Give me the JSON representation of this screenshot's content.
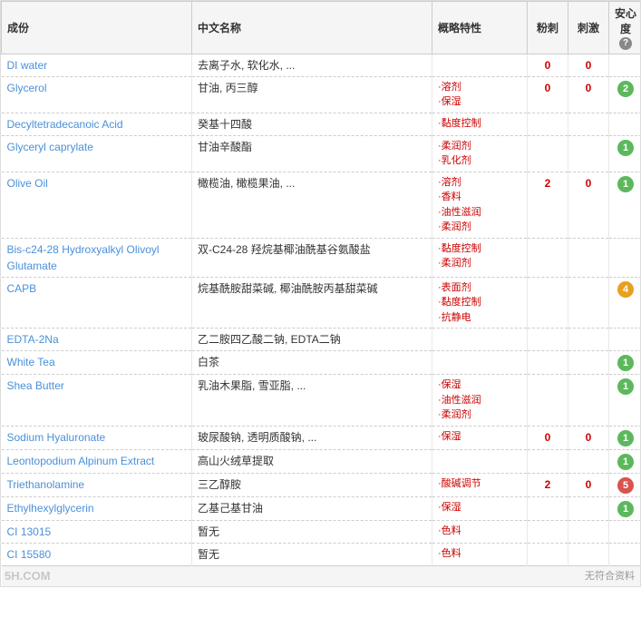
{
  "header": {
    "col_ingredient": "成份",
    "col_chinese": "中文名称",
    "col_general": "概略特性",
    "col_irritant": "粉刺",
    "col_stimulate": "刺激",
    "col_safety": "安心度"
  },
  "rows": [
    {
      "ingredient": "DI water",
      "chinese": "去离子水, 软化水, ...",
      "props": [],
      "irritant": "0",
      "stimulate": "0",
      "safety": null,
      "safety_color": null
    },
    {
      "ingredient": "Glycerol",
      "chinese": "甘油, 丙三醇",
      "props": [
        "·溶剂",
        "·保湿"
      ],
      "irritant": "0",
      "stimulate": "0",
      "safety": "2",
      "safety_color": "green"
    },
    {
      "ingredient": "Decyltetradecanoic Acid",
      "chinese": "癸基十四酸",
      "props": [
        "·黏度控制"
      ],
      "irritant": "",
      "stimulate": "",
      "safety": null,
      "safety_color": null
    },
    {
      "ingredient": "Glyceryl caprylate",
      "chinese": "甘油辛酸酯",
      "props": [
        "·柔润剂",
        "·乳化剂"
      ],
      "irritant": "",
      "stimulate": "",
      "safety": "1",
      "safety_color": "green"
    },
    {
      "ingredient": "Olive Oil",
      "chinese": "橄榄油, 橄榄果油, ...",
      "props": [
        "·溶剂",
        "·香料",
        "·油性滋润",
        "·柔润剂"
      ],
      "irritant": "2",
      "stimulate": "0",
      "safety": "1",
      "safety_color": "green"
    },
    {
      "ingredient": "Bis-c24-28 Hydroxyalkyl Olivoyl Glutamate",
      "chinese": "双-C24-28 羟烷基椰油酰基谷氨酸盐",
      "props": [
        "·黏度控制",
        "·柔润剂"
      ],
      "irritant": "",
      "stimulate": "",
      "safety": null,
      "safety_color": null
    },
    {
      "ingredient": "CAPB",
      "chinese": "烷基酰胺甜菜碱, 椰油酰胺丙基甜菜碱",
      "props": [
        "·表面剂",
        "·黏度控制",
        "·抗静电"
      ],
      "irritant": "",
      "stimulate": "",
      "safety": "4",
      "safety_color": "orange"
    },
    {
      "ingredient": "EDTA-2Na",
      "chinese": "乙二胺四乙酸二钠, EDTA二钠",
      "props": [],
      "irritant": "",
      "stimulate": "",
      "safety": null,
      "safety_color": null
    },
    {
      "ingredient": "White Tea",
      "chinese": "白茶",
      "props": [],
      "irritant": "",
      "stimulate": "",
      "safety": "1",
      "safety_color": "green"
    },
    {
      "ingredient": "Shea Butter",
      "chinese": "乳油木果脂, 雪亚脂, ...",
      "props": [
        "·保湿",
        "·油性滋润",
        "·柔润剂"
      ],
      "irritant": "",
      "stimulate": "",
      "safety": "1",
      "safety_color": "green"
    },
    {
      "ingredient": "Sodium Hyaluronate",
      "chinese": "玻尿酸钠, 透明质酸钠, ...",
      "props": [
        "·保湿"
      ],
      "irritant": "0",
      "stimulate": "0",
      "safety": "1",
      "safety_color": "green"
    },
    {
      "ingredient": "Leontopodium Alpinum Extract",
      "chinese": "高山火绒草提取",
      "props": [],
      "irritant": "",
      "stimulate": "",
      "safety": "1",
      "safety_color": "green"
    },
    {
      "ingredient": "Triethanolamine",
      "chinese": "三乙醇胺",
      "props": [
        "·酸碱调节"
      ],
      "irritant": "2",
      "stimulate": "0",
      "safety": "5",
      "safety_color": "red"
    },
    {
      "ingredient": "Ethylhexylglycerin",
      "chinese": "乙基己基甘油",
      "props": [
        "·保湿"
      ],
      "irritant": "",
      "stimulate": "",
      "safety": "1",
      "safety_color": "green"
    },
    {
      "ingredient": "CI 13015",
      "chinese": "暂无",
      "props": [
        "·色料"
      ],
      "irritant": "",
      "stimulate": "",
      "safety": null,
      "safety_color": null
    },
    {
      "ingredient": "CI 15580",
      "chinese": "暂无",
      "props": [
        "·色料"
      ],
      "irritant": "",
      "stimulate": "",
      "safety": null,
      "safety_color": null
    }
  ],
  "footer": {
    "text": "无符合资料"
  },
  "watermark": "5H.COM"
}
